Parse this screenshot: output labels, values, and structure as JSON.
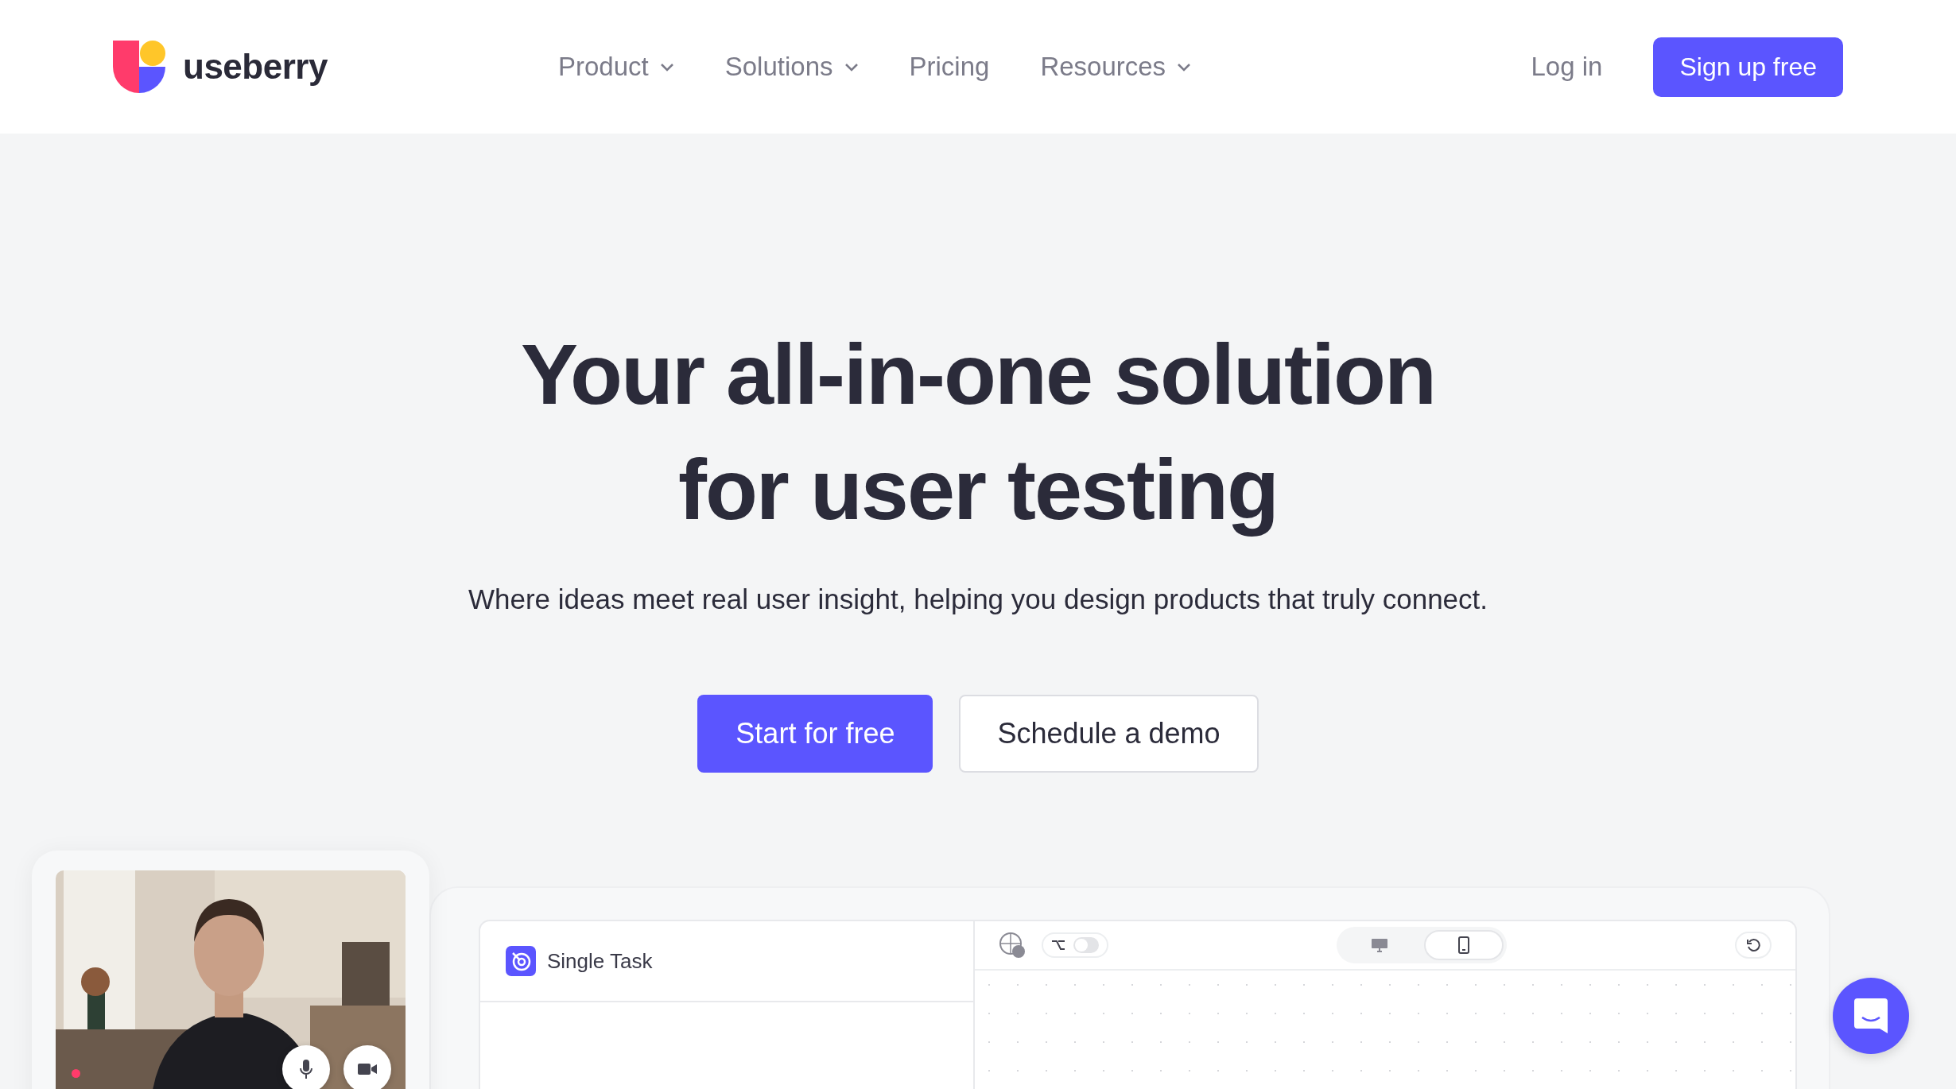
{
  "header": {
    "brand": "useberry",
    "nav": [
      {
        "label": "Product",
        "dropdown": true
      },
      {
        "label": "Solutions",
        "dropdown": true
      },
      {
        "label": "Pricing",
        "dropdown": false
      },
      {
        "label": "Resources",
        "dropdown": true
      }
    ],
    "login": "Log in",
    "signup": "Sign up free"
  },
  "hero": {
    "title_lines": [
      "Your all-in-one solution",
      "for user testing"
    ],
    "subtitle": "Where ideas meet real user insight, helping you design products that truly connect.",
    "primary": "Start for free",
    "secondary": "Schedule a demo"
  },
  "video": {
    "kind": "picture",
    "recording": true
  },
  "preview": {
    "task_title": "Single Task",
    "flow_toggle": {
      "on": false
    },
    "devices": [
      {
        "kind": "desktop",
        "selected": false
      },
      {
        "kind": "mobile",
        "selected": true
      }
    ]
  }
}
